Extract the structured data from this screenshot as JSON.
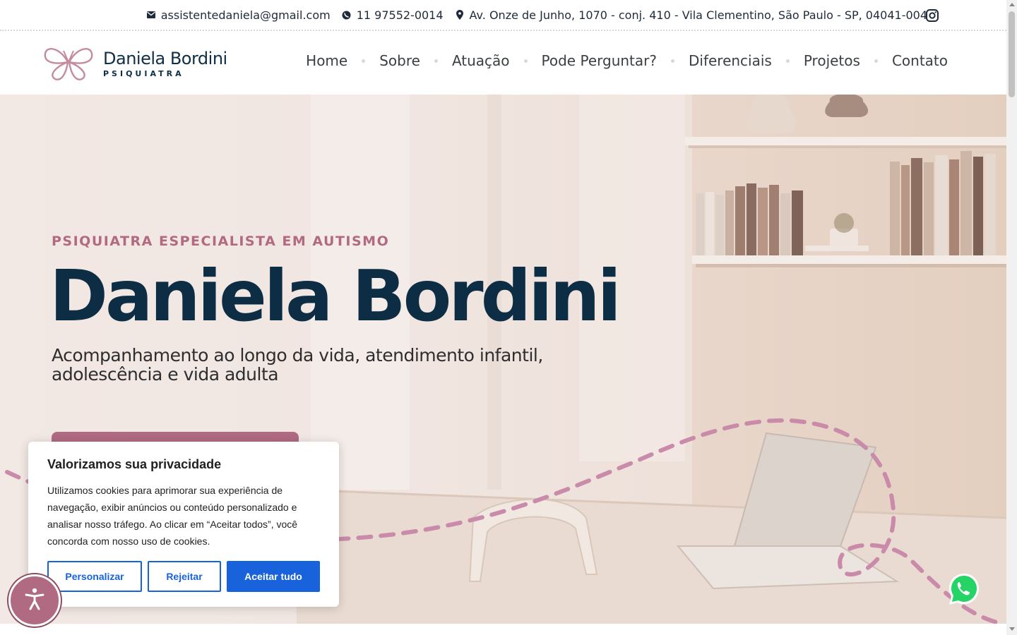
{
  "topbar": {
    "email": "assistentedaniela@gmail.com",
    "phone": "11 97552-0014",
    "address": "Av. Onze de Junho, 1070 - conj. 410 - Vila Clementino, São Paulo - SP, 04041-004",
    "icons": [
      "mail-icon",
      "whatsapp-icon",
      "location-pin-icon",
      "instagram-icon"
    ]
  },
  "header": {
    "logo_name": "Daniela Bordini",
    "logo_sub": "PSIQUIATRA",
    "nav": [
      "Home",
      "Sobre",
      "Atuação",
      "Pode Perguntar?",
      "Diferenciais",
      "Projetos",
      "Contato"
    ]
  },
  "hero": {
    "eyebrow": "PSIQUIATRA ESPECIALISTA EM AUTISMO",
    "title": "Daniela Bordini",
    "subtitle": "Acompanhamento ao longo da vida, atendimento infantil, adolescência e vida adulta"
  },
  "cookie": {
    "title": "Valorizamos sua privacidade",
    "text": "Utilizamos cookies para aprimorar sua experiência de navegação, exibir anúncios ou conteúdo personalizado e analisar nosso tráfego. Ao clicar em “Aceitar todos”, você concorda com nosso uso de cookies.",
    "customize": "Personalizar",
    "reject": "Rejeitar",
    "accept": "Aceitar tudo"
  },
  "colors": {
    "brand_pink": "#b06a82",
    "brand_navy": "#0d2d44",
    "cookie_blue": "#1863dc",
    "whatsapp_green": "#25d366"
  }
}
